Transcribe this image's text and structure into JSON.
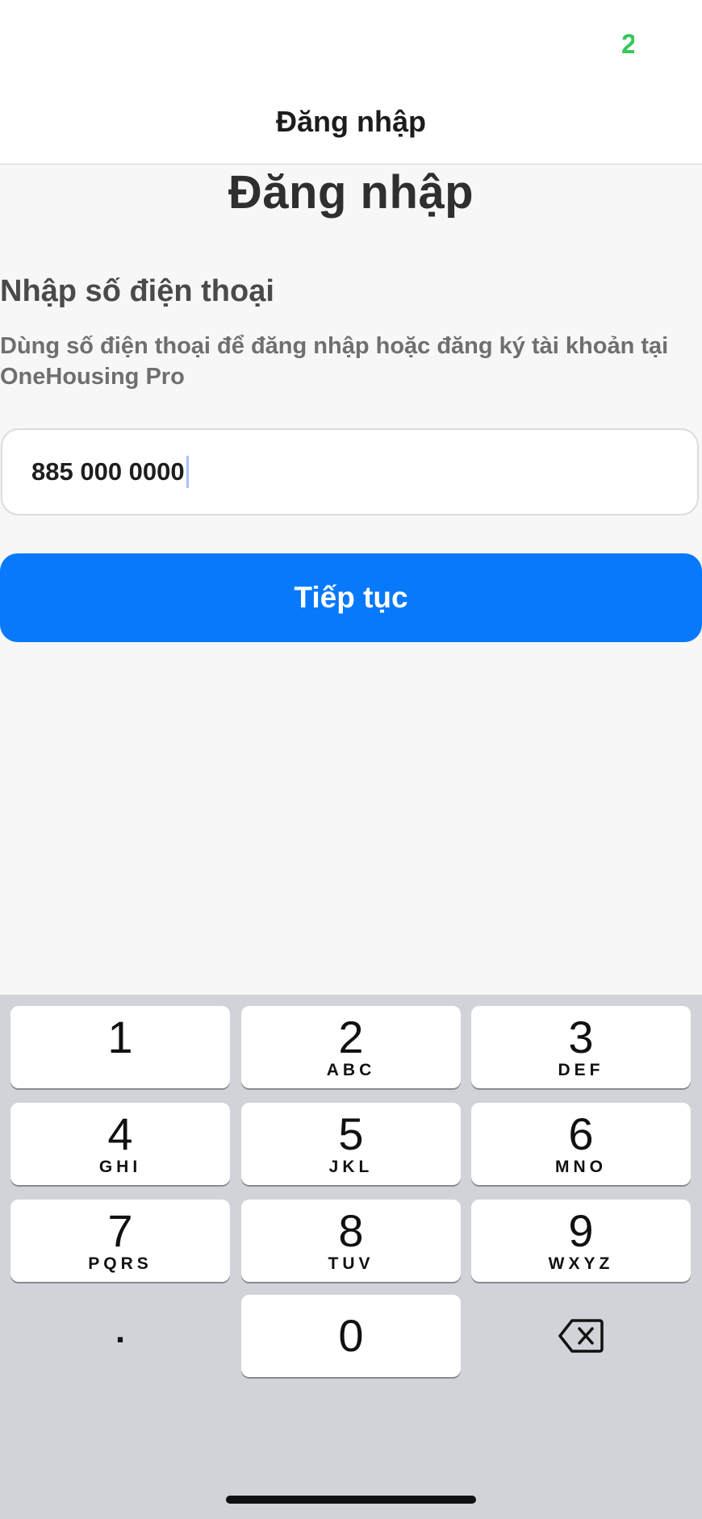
{
  "status_bar": {
    "battery_glyph": "2"
  },
  "nav": {
    "title": "Đăng nhập"
  },
  "page": {
    "heading": "Đăng nhập",
    "section_title": "Nhập số điện thoại",
    "section_description": "Dùng số điện thoại để đăng nhập hoặc đăng ký tài khoản tại OneHousing Pro"
  },
  "phone_input": {
    "value": "885 000 0000"
  },
  "continue_button": {
    "label": "Tiếp tục"
  },
  "keypad": {
    "keys": [
      {
        "digit": "1",
        "letters": ""
      },
      {
        "digit": "2",
        "letters": "ABC"
      },
      {
        "digit": "3",
        "letters": "DEF"
      },
      {
        "digit": "4",
        "letters": "GHI"
      },
      {
        "digit": "5",
        "letters": "JKL"
      },
      {
        "digit": "6",
        "letters": "MNO"
      },
      {
        "digit": "7",
        "letters": "PQRS"
      },
      {
        "digit": "8",
        "letters": "TUV"
      },
      {
        "digit": "9",
        "letters": "WXYZ"
      },
      {
        "digit": "0",
        "letters": ""
      }
    ],
    "dot_label": ".",
    "delete_icon": "backspace-icon"
  },
  "colors": {
    "primary_button": "#0879fa",
    "battery": "#34c759",
    "keypad_background": "#d1d3d9"
  }
}
